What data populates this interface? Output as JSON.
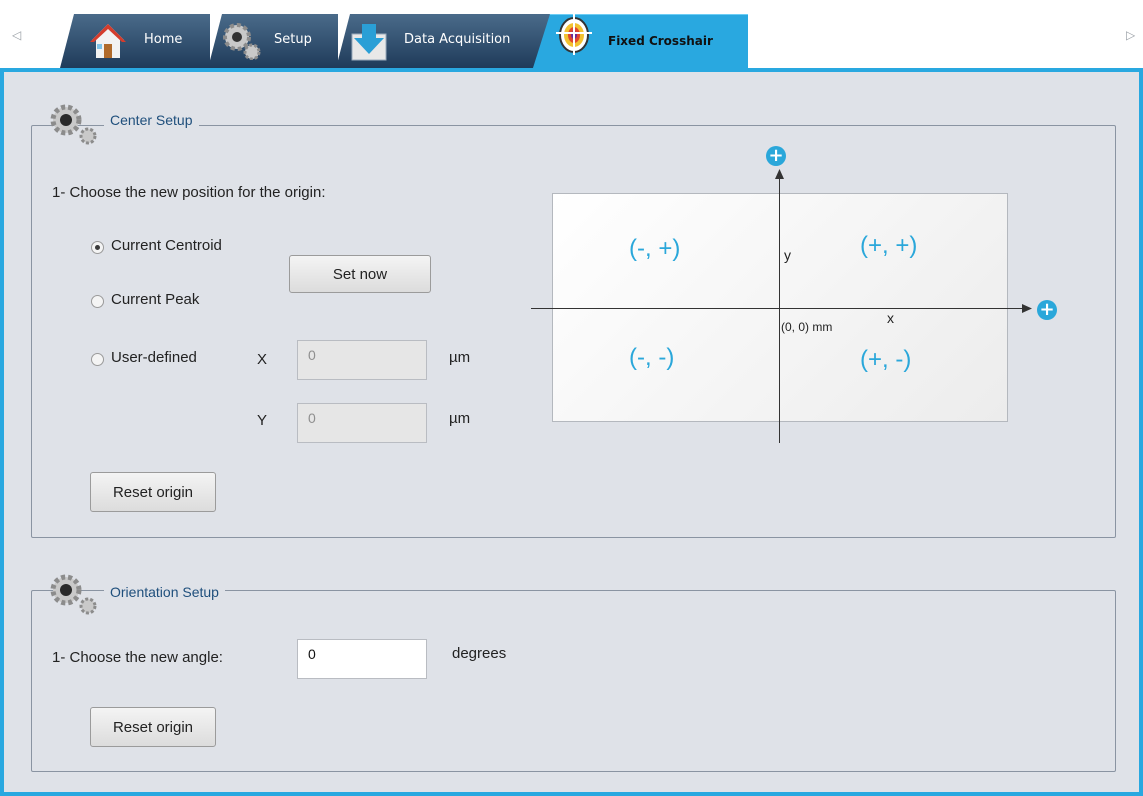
{
  "tabs": [
    {
      "label": "Home",
      "icon": "home-icon"
    },
    {
      "label": "Setup",
      "icon": "gears-icon"
    },
    {
      "label": "Data Acquisition",
      "icon": "download-icon"
    },
    {
      "label": "Fixed Crosshair",
      "icon": "crosshair-target-icon",
      "active": true
    }
  ],
  "scroll": {
    "left": "◁",
    "right": "▷"
  },
  "center_setup": {
    "title": "Center Setup",
    "instruction": "1- Choose the new position for the origin:",
    "options": [
      {
        "label": "Current Centroid",
        "selected": true
      },
      {
        "label": "Current Peak",
        "selected": false
      },
      {
        "label": "User-defined",
        "selected": false
      }
    ],
    "set_now_label": "Set now",
    "x_label": "X",
    "y_label": "Y",
    "x_value": "0",
    "y_value": "0",
    "unit": "µm",
    "reset_label": "Reset origin",
    "diagram": {
      "q_top_left": "(-, +)",
      "q_top_right": "(+, +)",
      "q_bottom_left": "(-, -)",
      "q_bottom_right": "(+, -)",
      "y_axis": "y",
      "x_axis": "x",
      "origin": "(0, 0) mm",
      "plus": "+"
    }
  },
  "orientation_setup": {
    "title": "Orientation Setup",
    "instruction": "1- Choose the new angle:",
    "angle_value": "0",
    "unit": "degrees",
    "reset_label": "Reset origin"
  },
  "colors": {
    "accent": "#29a8e0",
    "panel": "#dfe2e8",
    "title": "#1f4f7c"
  }
}
